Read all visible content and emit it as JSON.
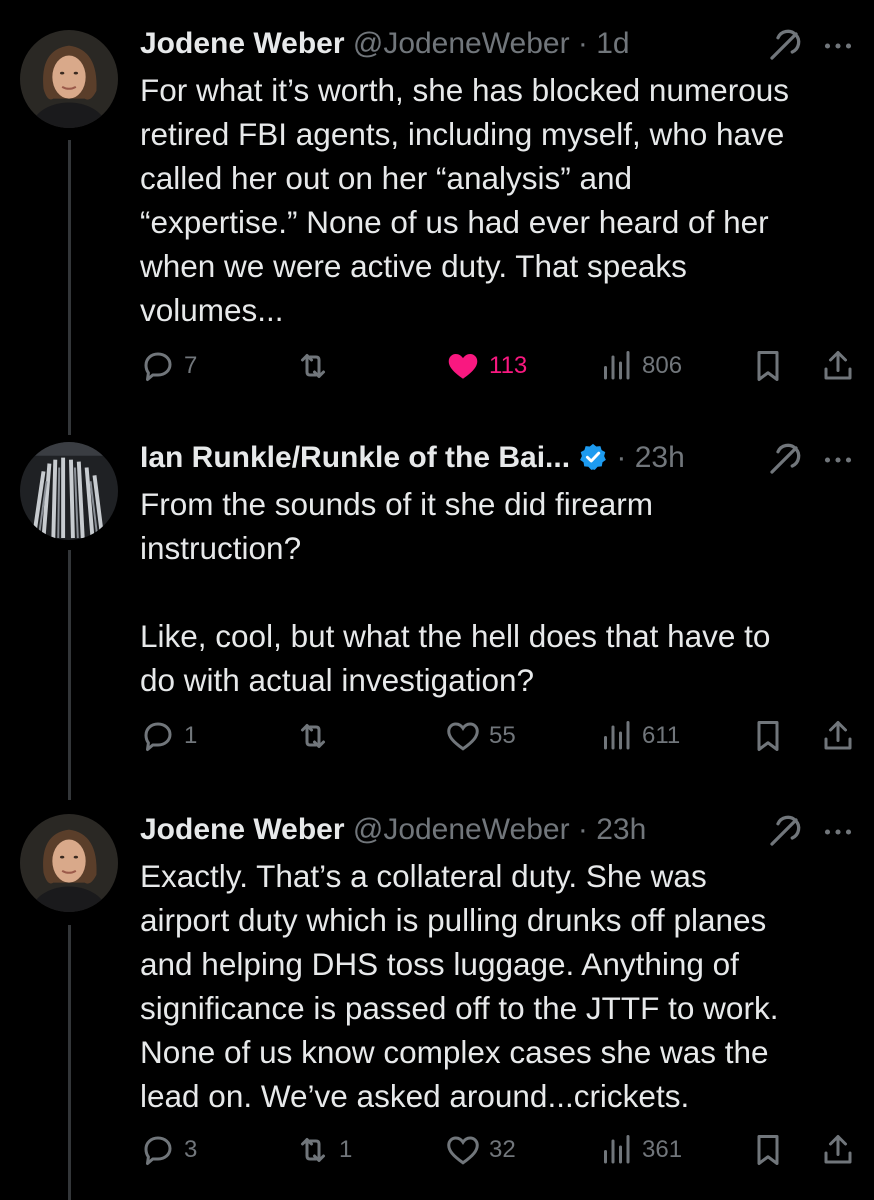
{
  "tweets": [
    {
      "name": "Jodene Weber",
      "handle": "@JodeneWeber",
      "time": "· 1d",
      "text": "For what it’s worth, she has blocked numerous\nretired FBI agents, including myself, who have\ncalled her out on her “analysis” and\n“expertise.” None of us had ever heard of her\nwhen we were active duty. That speaks\nvolumes...",
      "replies": "7",
      "reposts": "",
      "likes": "113",
      "views": "806",
      "liked": true
    },
    {
      "name": "Ian Runkle/Runkle of the Bai...",
      "handle": "",
      "time": "· 23h",
      "verified": true,
      "text": "From the sounds of it she did firearm\ninstruction?\n\nLike, cool, but what the hell does that have to\ndo with actual investigation?",
      "replies": "1",
      "reposts": "",
      "likes": "55",
      "views": "611",
      "liked": false
    },
    {
      "name": "Jodene Weber",
      "handle": "@JodeneWeber",
      "time": "· 23h",
      "text": "Exactly. That’s a collateral duty. She was\nairport duty which is pulling drunks off planes\nand helping DHS toss luggage. Anything of\nsignificance is passed off to the JTTF to work.\nNone of us know complex cases she was the\nlead on. We’ve asked around...crickets.",
      "replies": "3",
      "reposts": "1",
      "likes": "32",
      "views": "361",
      "liked": false
    }
  ],
  "colors": {
    "background": "#000000",
    "text": "#e7e9ea",
    "muted": "#71767b",
    "like": "#f91880",
    "verified": "#1d9bf0"
  }
}
